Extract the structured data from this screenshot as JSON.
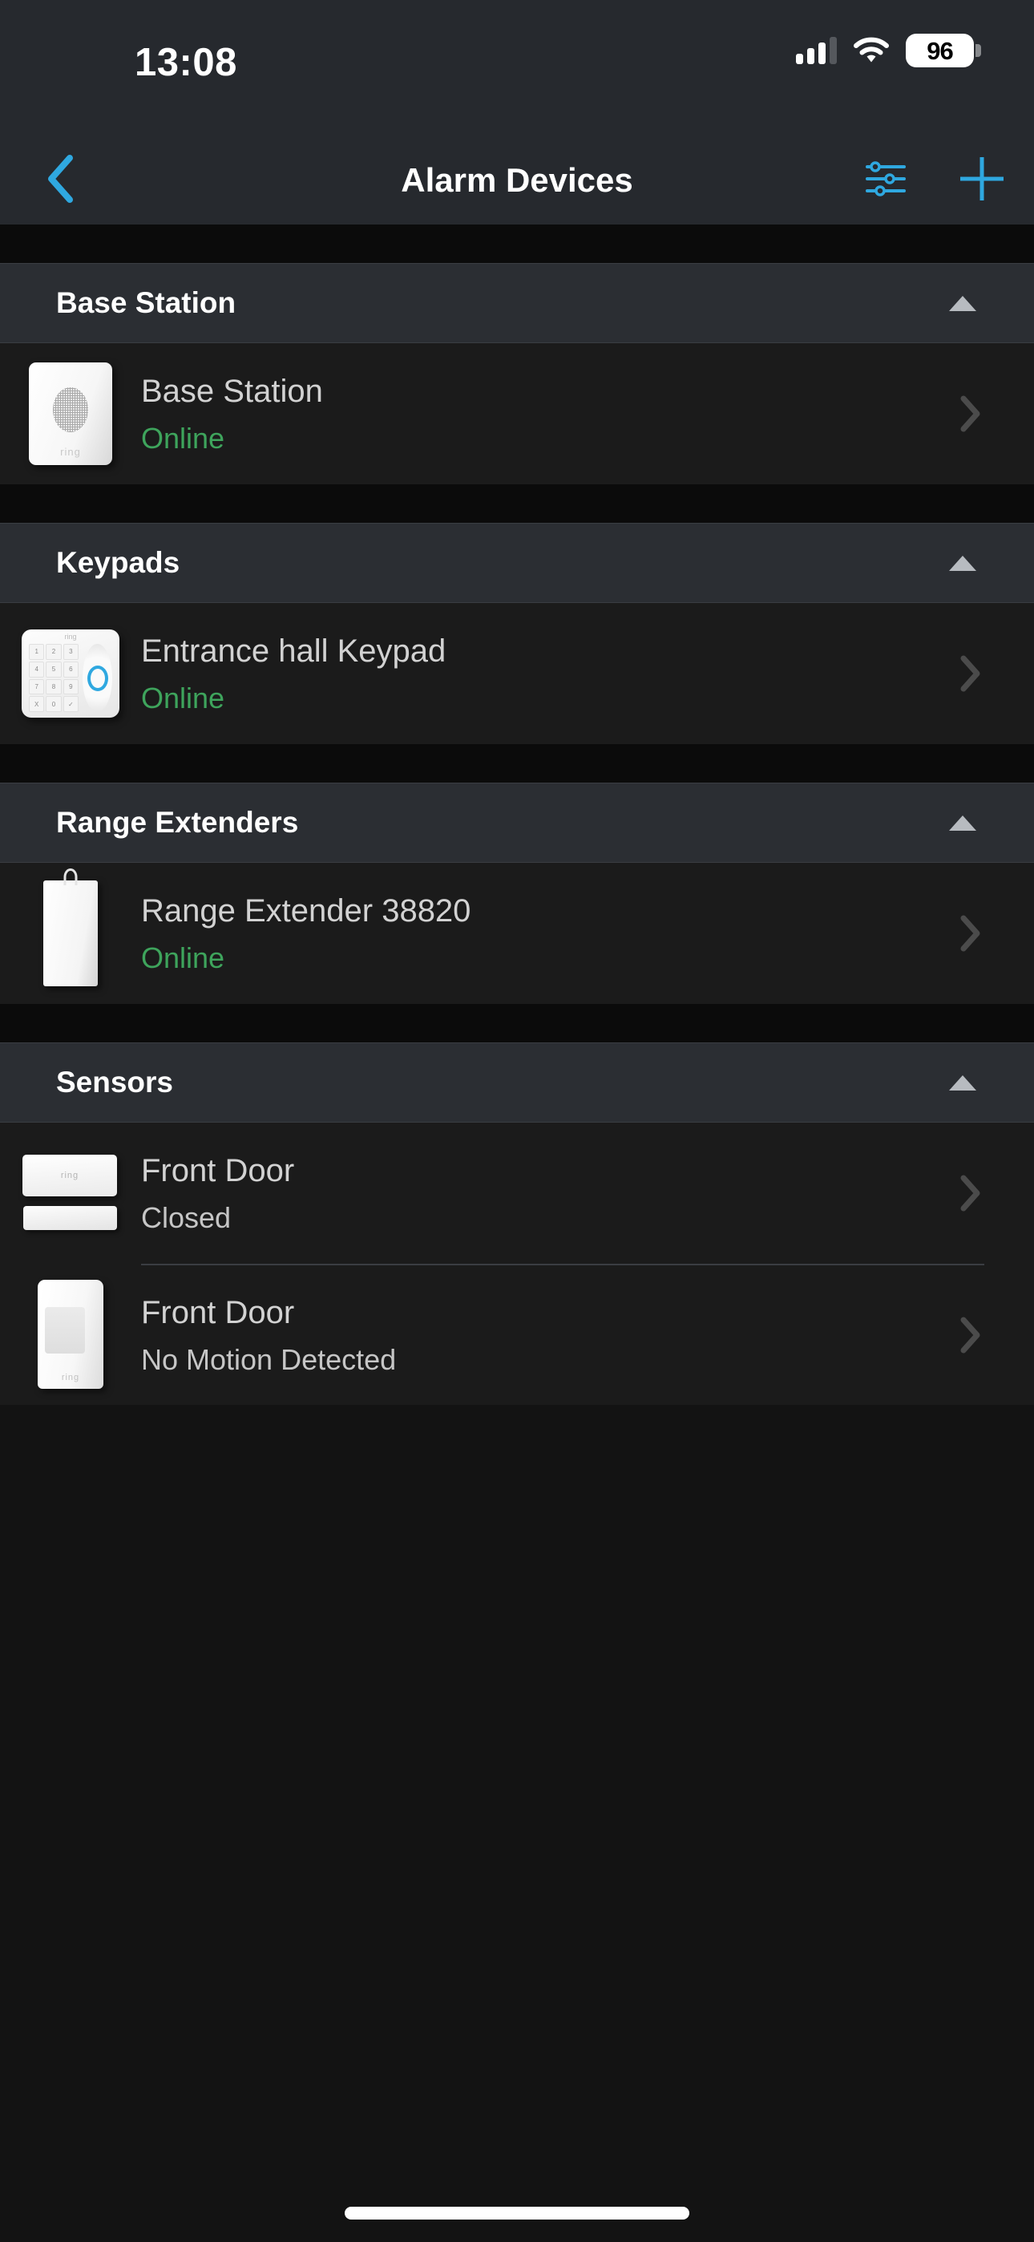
{
  "status_bar": {
    "time": "13:08",
    "battery_percent": "96",
    "cellular_icon": "cellular-signal-icon",
    "wifi_icon": "wifi-icon",
    "battery_icon": "battery-icon"
  },
  "nav_bar": {
    "back_icon": "chevron-left-icon",
    "title": "Alarm Devices",
    "filter_icon": "sliders-filter-icon",
    "add_icon": "plus-icon",
    "accent_color": "#2fa8e0"
  },
  "colors": {
    "page_background": "#131313",
    "section_header_background": "#2b2e33",
    "row_background": "#1b1b1b",
    "gap_strip": "#0b0b0b",
    "online_green": "#3ea45c",
    "primary_text": "#d2d2d2",
    "heading_text": "#ffffff"
  },
  "sections": [
    {
      "title": "Base Station",
      "collapse_icon": "triangle-up-icon",
      "expanded": true,
      "devices": [
        {
          "name": "Base Station",
          "status": "Online",
          "status_type": "online",
          "thumb_icon": "base-station-device-icon",
          "chevron_icon": "chevron-right-icon"
        }
      ]
    },
    {
      "title": "Keypads",
      "collapse_icon": "triangle-up-icon",
      "expanded": true,
      "devices": [
        {
          "name": "Entrance hall Keypad",
          "status": "Online",
          "status_type": "online",
          "thumb_icon": "keypad-device-icon",
          "chevron_icon": "chevron-right-icon",
          "keypad_keys": [
            "1",
            "2",
            "3",
            "4",
            "5",
            "6",
            "7",
            "8",
            "9",
            "X",
            "0",
            "✓"
          ],
          "keypad_brand": "ring"
        }
      ]
    },
    {
      "title": "Range Extenders",
      "collapse_icon": "triangle-up-icon",
      "expanded": true,
      "devices": [
        {
          "name": "Range Extender 38820",
          "status": "Online",
          "status_type": "online",
          "thumb_icon": "range-extender-device-icon",
          "chevron_icon": "chevron-right-icon"
        }
      ]
    },
    {
      "title": "Sensors",
      "collapse_icon": "triangle-up-icon",
      "expanded": true,
      "devices": [
        {
          "name": "Front Door",
          "status": "Closed",
          "status_type": "neutral",
          "thumb_icon": "contact-sensor-device-icon",
          "chevron_icon": "chevron-right-icon",
          "brand": "ring"
        },
        {
          "name": "Front Door",
          "status": "No Motion Detected",
          "status_type": "neutral",
          "thumb_icon": "motion-sensor-device-icon",
          "chevron_icon": "chevron-right-icon",
          "brand": "ring"
        }
      ]
    }
  ],
  "home_indicator": "home-indicator-bar"
}
